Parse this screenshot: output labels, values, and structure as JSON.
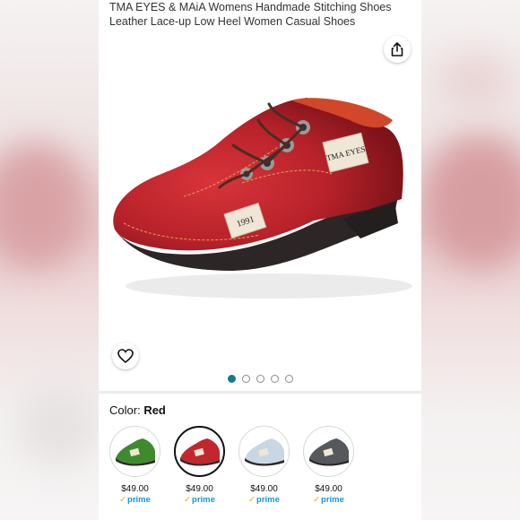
{
  "product": {
    "title": "TMA EYES & MAiA Womens Handmade Stitching Shoes Leather Lace-up Low Heel Women Casual Shoes"
  },
  "image_label_year": "1991",
  "image_label_brand": "TMA EYES",
  "carousel": {
    "count": 5,
    "active_index": 0
  },
  "color": {
    "label": "Color:",
    "selected": "Red"
  },
  "variants": [
    {
      "color": "Green",
      "hex": "#3f8a2c",
      "price": "$49.00",
      "prime": "prime"
    },
    {
      "color": "Red",
      "hex": "#c1272d",
      "price": "$49.00",
      "prime": "prime"
    },
    {
      "color": "Light Blue",
      "hex": "#c9d7e4",
      "price": "$49.00",
      "prime": "prime"
    },
    {
      "color": "Gray",
      "hex": "#55585c",
      "price": "$49.00",
      "prime": "prime"
    }
  ],
  "icons": {
    "share": "share-icon",
    "wishlist": "heart-icon",
    "prime_check": "check-icon"
  },
  "colors": {
    "accent": "#147c8e",
    "prime": "#1399d6",
    "prime_check": "#f0a30a",
    "shoe": "#c1272d"
  }
}
